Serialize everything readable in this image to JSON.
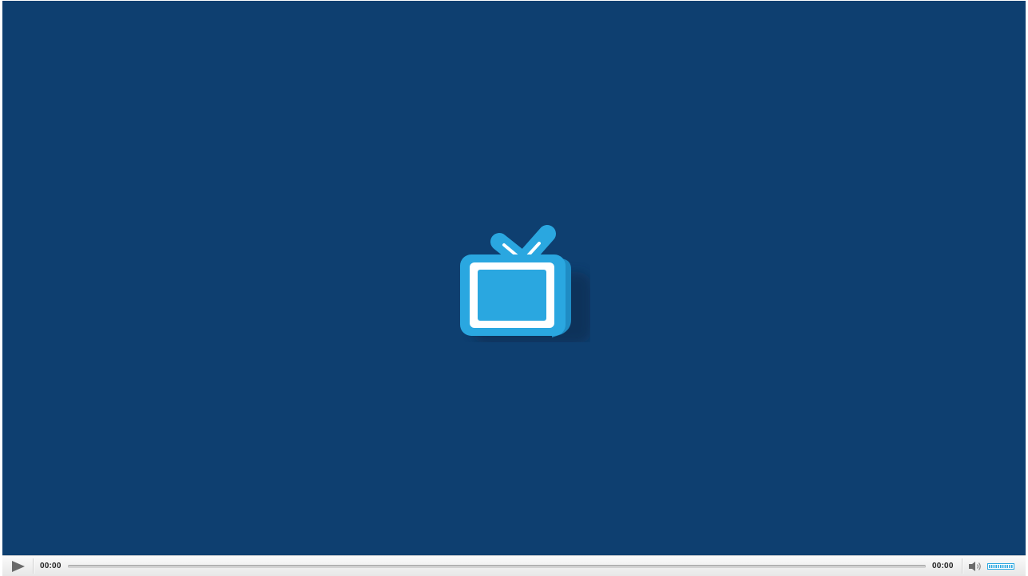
{
  "player": {
    "background_color": "#0e3f70",
    "logo": {
      "icon": "tv-icon",
      "body_color": "#2aa7e0",
      "frame_color": "#ffffff"
    }
  },
  "controls": {
    "play_icon": "play-icon",
    "current_time": "00:00",
    "duration": "00:00",
    "progress_percent": 0,
    "volume_icon": "speaker-icon",
    "volume_percent": 100,
    "accent_color": "#2aa7e0"
  }
}
